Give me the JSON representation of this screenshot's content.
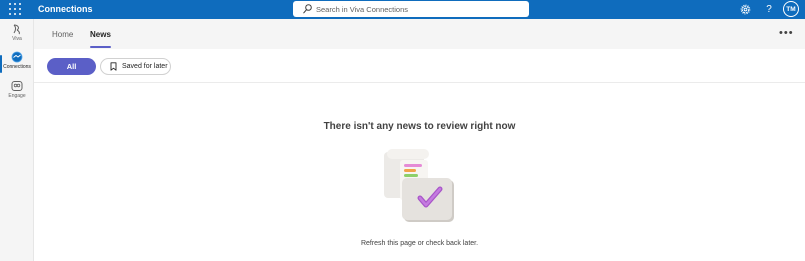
{
  "topbar": {
    "app_title": "Connections",
    "search_placeholder": "Search in Viva Connections",
    "avatar_initials": "TM",
    "brand_color": "#0f6cbd"
  },
  "rail": {
    "items": [
      {
        "label": "Viva",
        "icon": "viva-icon"
      },
      {
        "label": "Connections",
        "icon": "connections-icon",
        "active": true
      },
      {
        "label": "Engage",
        "icon": "engage-icon"
      }
    ]
  },
  "tabs": {
    "items": [
      {
        "label": "Home"
      },
      {
        "label": "News",
        "active": true
      }
    ]
  },
  "filters": {
    "all_label": "All",
    "saved_label": "Saved for later",
    "accent_color": "#5b5fc7"
  },
  "empty_state": {
    "title": "There isn't any news to review right now",
    "subtitle": "Refresh this page or check back later."
  }
}
